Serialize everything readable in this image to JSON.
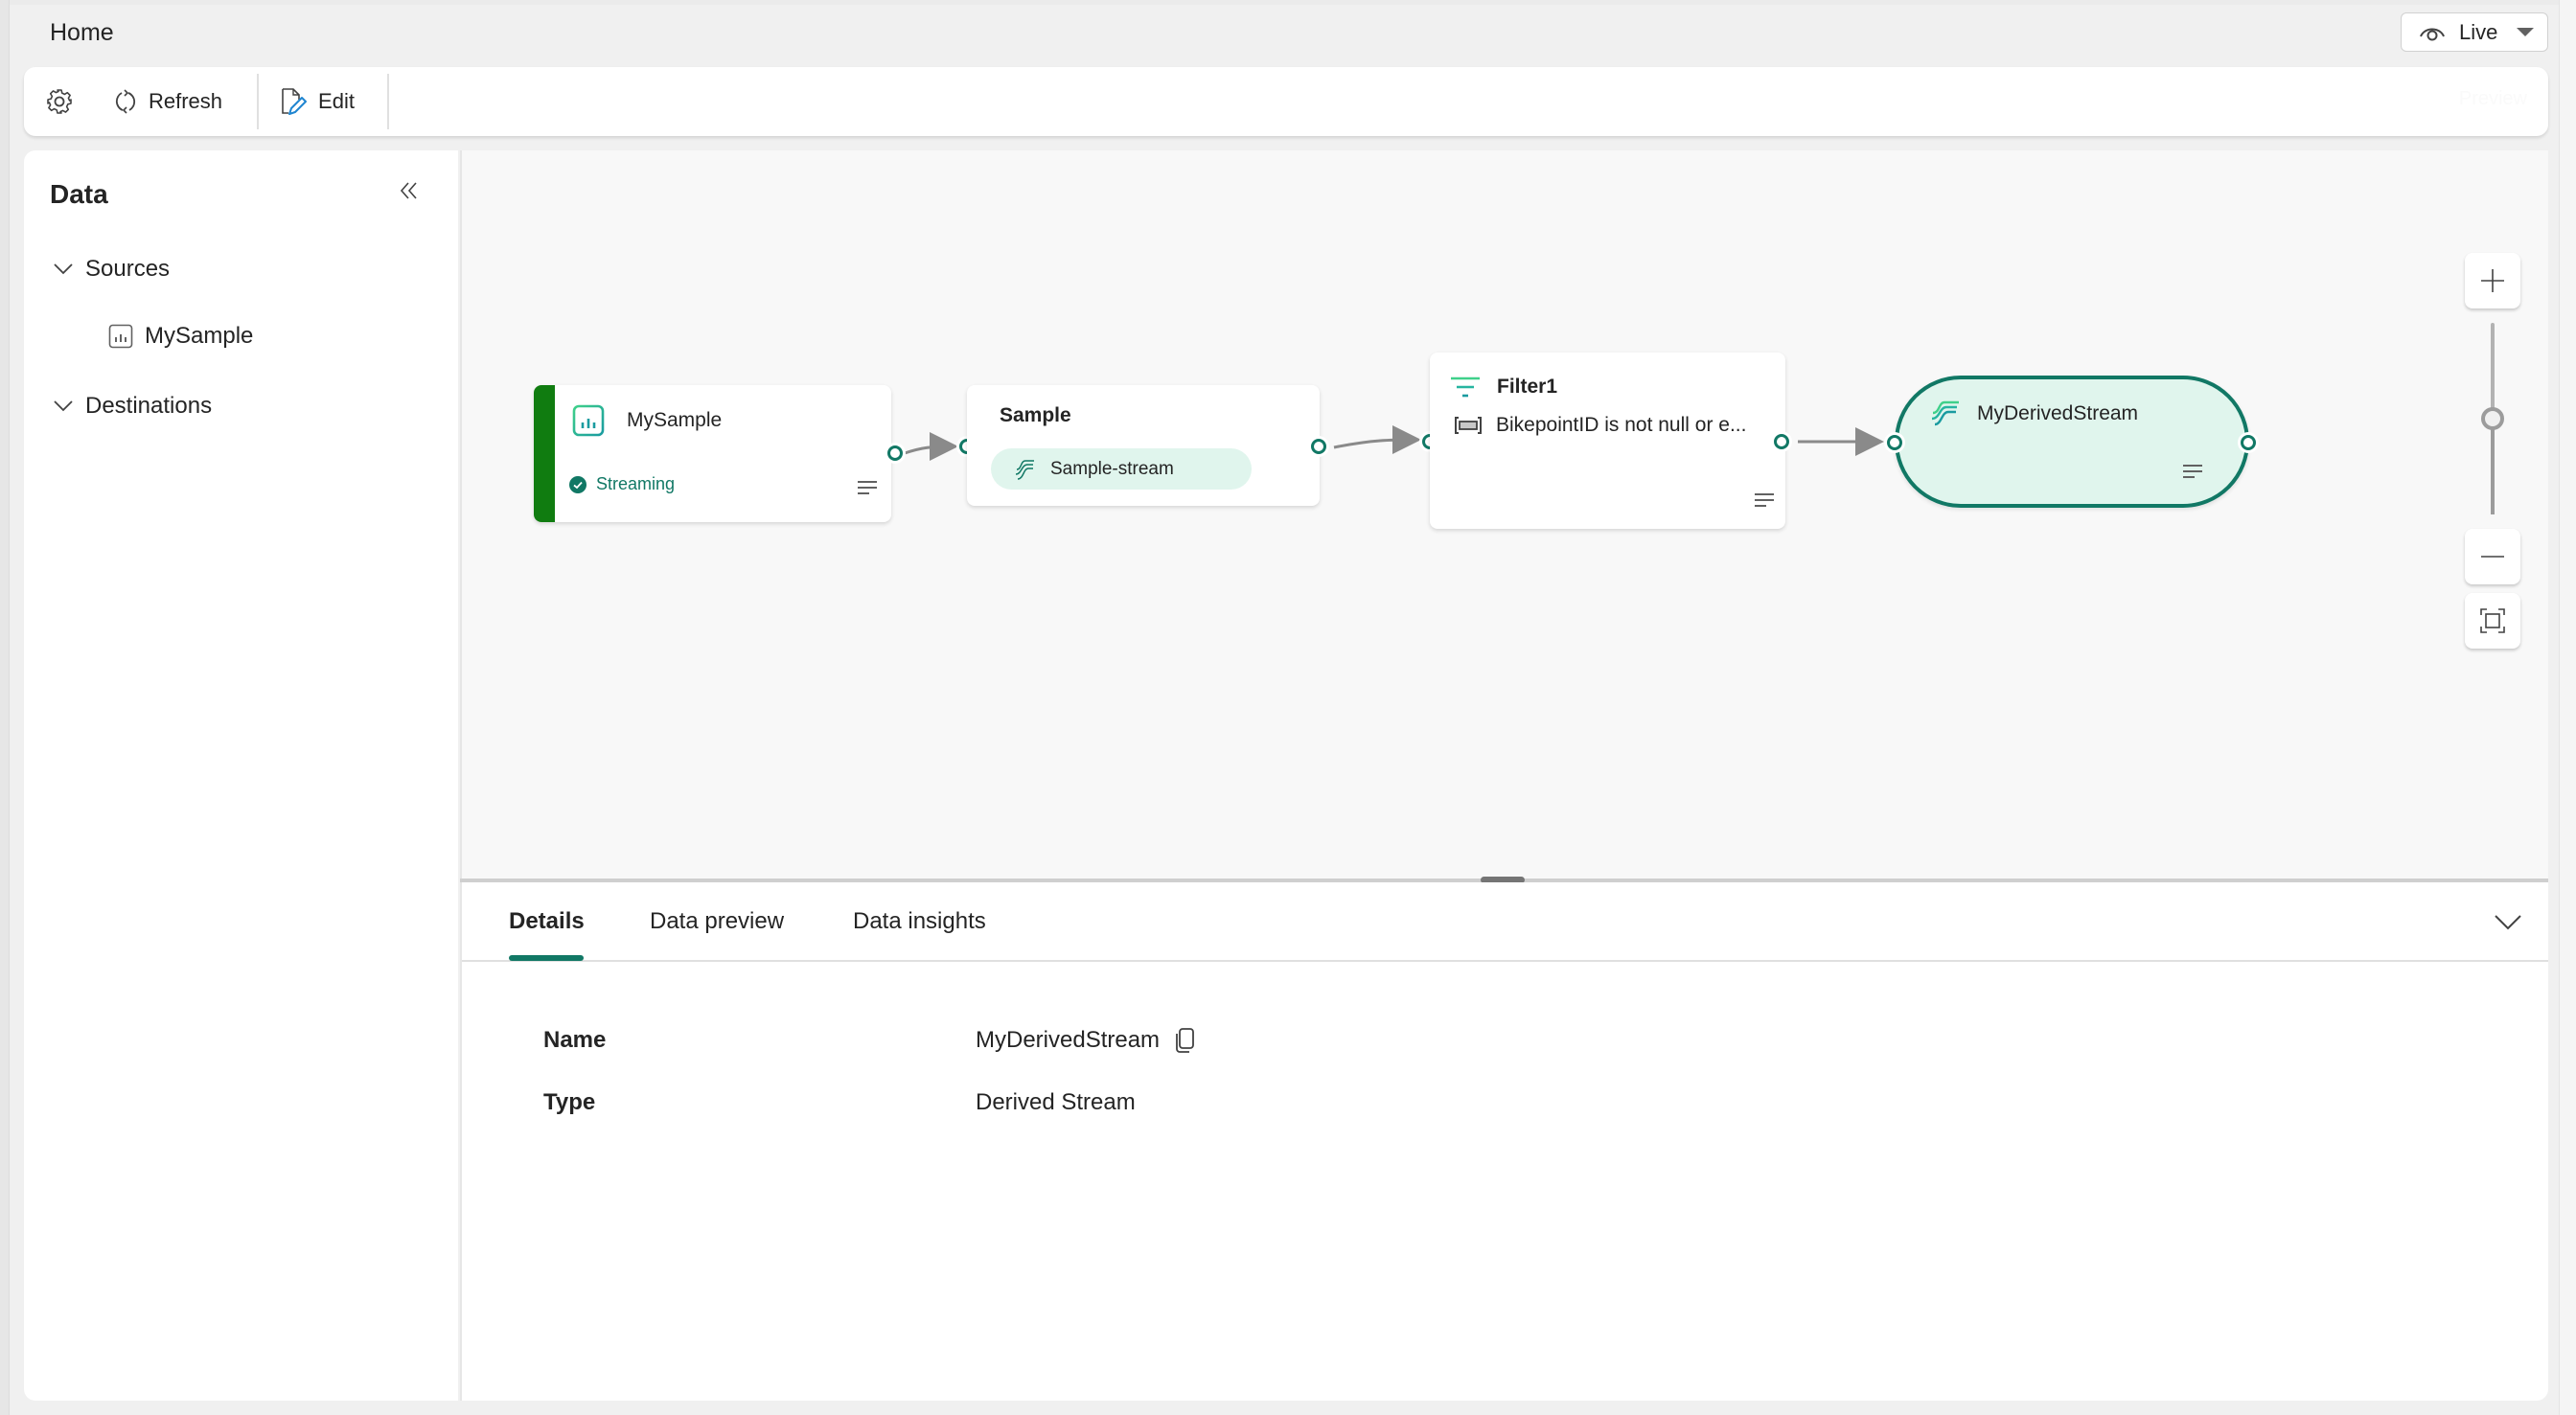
{
  "ribbon": {
    "tabs": [
      {
        "label": "Home",
        "active": true
      }
    ],
    "view_mode": {
      "label": "Live",
      "icon": "eye-icon"
    }
  },
  "toolbar": {
    "settings_icon": "gear-icon",
    "refresh_label": "Refresh",
    "refresh_icon": "refresh-icon",
    "edit_label": "Edit",
    "edit_icon": "edit-icon",
    "faded_label": "Preview"
  },
  "data_panel": {
    "title": "Data",
    "collapse_icon": "double-chevron-left-icon",
    "sections": [
      {
        "label": "Sources",
        "expanded": true,
        "items": [
          {
            "label": "MySample",
            "icon": "chart-source-icon"
          }
        ]
      },
      {
        "label": "Destinations",
        "expanded": true,
        "items": []
      }
    ]
  },
  "canvas": {
    "nodes": [
      {
        "id": "mysample",
        "title": "MySample",
        "kind": "source",
        "icon": "chart-source-icon",
        "status": "Streaming",
        "status_icon": "check-circle-icon"
      },
      {
        "id": "sample",
        "title": "Sample",
        "kind": "eventstream",
        "stream_label": "Sample-stream",
        "stream_icon": "stream-icon"
      },
      {
        "id": "filter1",
        "title": "Filter1",
        "kind": "filter",
        "icon": "filter-icon",
        "condition": "BikepointID is not null or e...",
        "condition_icon": "field-icon"
      },
      {
        "id": "derived",
        "title": "MyDerivedStream",
        "kind": "derived-stream",
        "icon": "stream-icon"
      }
    ],
    "edges": [
      [
        "mysample",
        "sample"
      ],
      [
        "sample",
        "filter1"
      ],
      [
        "filter1",
        "derived"
      ]
    ],
    "zoom": {
      "zoom_in_icon": "plus-icon",
      "zoom_out_icon": "minus-icon",
      "fit_icon": "fit-to-screen-icon",
      "level": 0.5
    }
  },
  "bottom_pane": {
    "tabs": [
      {
        "label": "Details",
        "active": true
      },
      {
        "label": "Data preview",
        "active": false
      },
      {
        "label": "Data insights",
        "active": false
      }
    ],
    "details": [
      {
        "label": "Name",
        "value": "MyDerivedStream",
        "copyable": true
      },
      {
        "label": "Type",
        "value": "Derived Stream",
        "copyable": false
      }
    ]
  },
  "colors": {
    "accent": "#117865",
    "source_bar": "#107c10",
    "stream_fill": "#e0f5ed",
    "canvas_bg": "#f8f8f8"
  }
}
